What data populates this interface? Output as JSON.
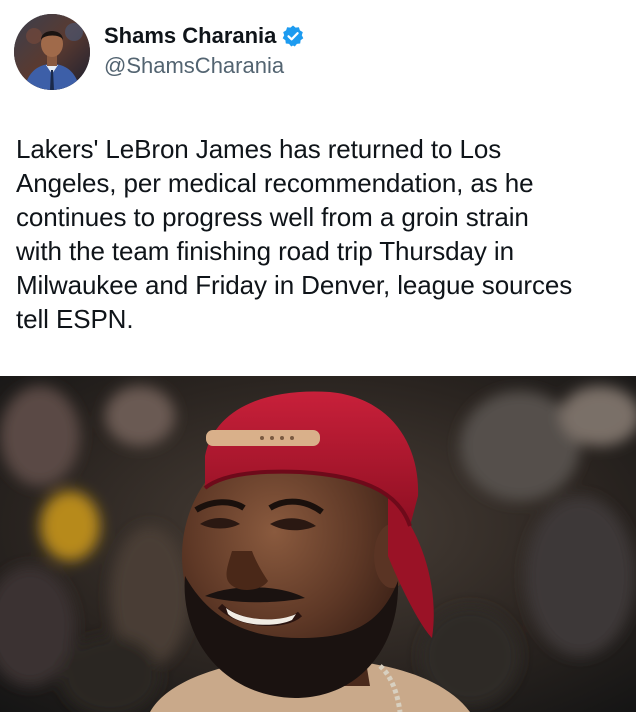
{
  "author": {
    "display_name": "Shams Charania",
    "handle": "@ShamsCharania",
    "verified": true,
    "verified_color": "#1d9bf0",
    "avatar_icon": "profile-photo"
  },
  "tweet": {
    "text": "Lakers' LeBron James has returned to Los\nAngeles, per medical recommendation, as he\ncontinues to progress well from a groin strain\nwith the team finishing road trip Thursday in\nMilwaukee and Friday in Denver, league sources\ntell ESPN."
  },
  "media": {
    "icon": "photo-player-red-cap"
  },
  "colors": {
    "text_primary": "#0f1419",
    "text_secondary": "#536471",
    "cap_red": "#b3142a"
  }
}
